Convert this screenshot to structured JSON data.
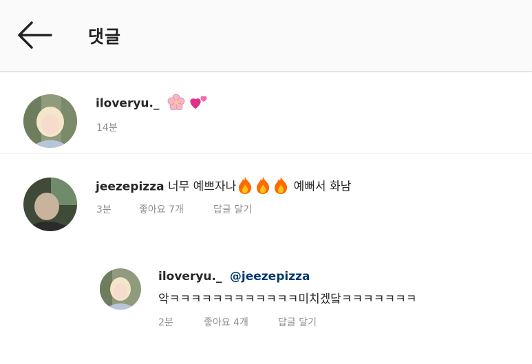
{
  "header": {
    "title": "댓글"
  },
  "comments": [
    {
      "username": "iloveryu._",
      "emojis": [
        "cherry-blossom-icon",
        "two-hearts-icon"
      ],
      "time": "14분"
    },
    {
      "username": "jeezepizza",
      "text_before": "너무 예쁘자나",
      "fire_count": 3,
      "text_after": "예뻐서 화남",
      "time": "3분",
      "likes": "좋아요 7개",
      "reply": "답글 달기"
    }
  ],
  "reply": {
    "username": "iloveryu._",
    "mention": "@jeezepizza",
    "text": "악ㅋㅋㅋㅋㅋㅋㅋㅋㅋㅋㅋㅋ미치겠닼ㅋㅋㅋㅋㅋㅋㅋ",
    "time": "2분",
    "likes": "좋아요 4개",
    "reply": "답글 달기"
  },
  "colors": {
    "header_bg": "#fafafa",
    "mention": "#00376b",
    "meta": "#8e8e8e",
    "fire": "#ff6a00"
  }
}
